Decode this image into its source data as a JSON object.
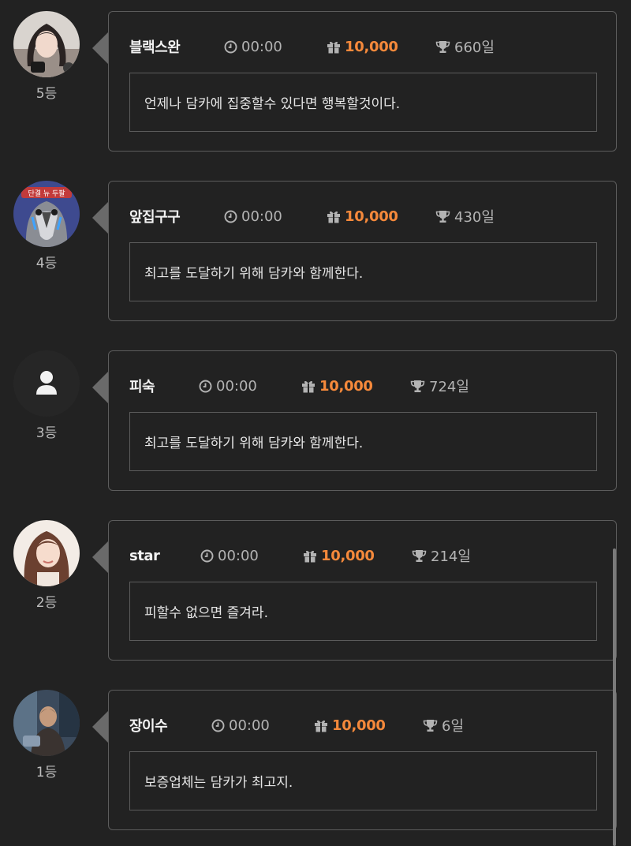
{
  "entries": [
    {
      "rank": "5등",
      "name": "블랙스완",
      "time": "00:00",
      "amount": "10,000",
      "days": "660일",
      "message": "언제나 담카에 집중할수 있다면 행복할것이다.",
      "avatar": "photo-woman-dark-hair"
    },
    {
      "rank": "4등",
      "name": "앞집구구",
      "time": "00:00",
      "amount": "10,000",
      "days": "430일",
      "message": "최고를 도달하기 위해 담카와 함께한다.",
      "avatar": "pigeon-cartoon"
    },
    {
      "rank": "3등",
      "name": "피숙",
      "time": "00:00",
      "amount": "10,000",
      "days": "724일",
      "message": "최고를 도달하기 위해 담카와 함께한다.",
      "avatar": "default-user-icon"
    },
    {
      "rank": "2등",
      "name": "star",
      "time": "00:00",
      "amount": "10,000",
      "days": "214일",
      "message": "피할수 없으면 즐겨라.",
      "avatar": "photo-woman-light"
    },
    {
      "rank": "1등",
      "name": "장이수",
      "time": "00:00",
      "amount": "10,000",
      "days": "6일",
      "message": "보증업체는 담카가 최고지.",
      "avatar": "photo-man-scene"
    }
  ],
  "colors": {
    "background": "#222222",
    "amount": "#f5893b",
    "border": "#5c5c5c"
  },
  "icons": {
    "time": "clock-icon",
    "amount": "gift-icon",
    "days": "trophy-icon"
  }
}
